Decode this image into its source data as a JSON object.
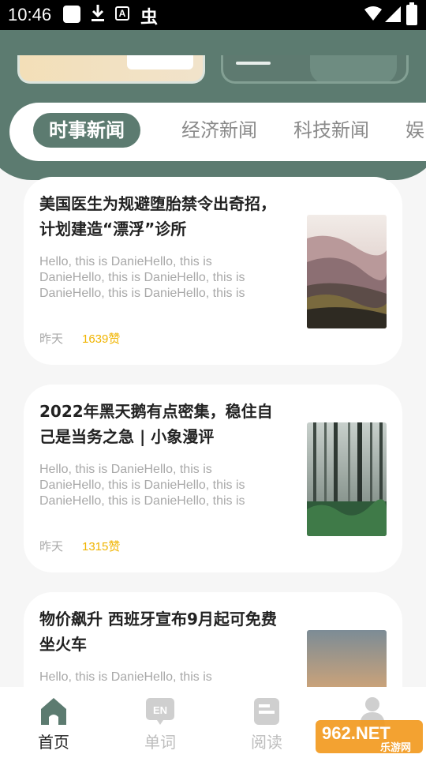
{
  "status_bar": {
    "time": "10:46"
  },
  "tabs": [
    {
      "label": "时事新闻",
      "active": true
    },
    {
      "label": "经济新闻",
      "active": false
    },
    {
      "label": "科技新闻",
      "active": false
    },
    {
      "label": "娱",
      "active": false
    }
  ],
  "articles": [
    {
      "title": "美国医生为规避堕胎禁令出奇招，计划建造“漂浮”诊所",
      "excerpt": "Hello, this is DanieHello, this is DanieHello, this is DanieHello, this is DanieHello, this is DanieHello, this is",
      "date": "昨天",
      "likes": "1639赞"
    },
    {
      "title": "2022年黑天鹅有点密集，稳住自己是当务之急 | 小象漫评",
      "excerpt": "Hello, this is DanieHello, this is DanieHello, this is DanieHello, this is DanieHello, this is DanieHello, this is",
      "date": "昨天",
      "likes": "1315赞"
    },
    {
      "title": "物价飙升 西班牙宣布9月起可免费坐火车",
      "excerpt": "Hello, this is DanieHello, this is",
      "date": "",
      "likes": ""
    }
  ],
  "bottom_nav": [
    {
      "label": "首页",
      "icon": "home-icon",
      "active": true
    },
    {
      "label": "单词",
      "icon": "en-word-icon",
      "active": false
    },
    {
      "label": "阅读",
      "icon": "reading-icon",
      "active": false
    },
    {
      "label": "",
      "icon": "profile-icon",
      "active": false
    }
  ],
  "watermark": {
    "text": "962.NET",
    "subtext": "乐游网"
  },
  "colors": {
    "brand_green": "#5c7b70",
    "likes": "#f0b400"
  }
}
